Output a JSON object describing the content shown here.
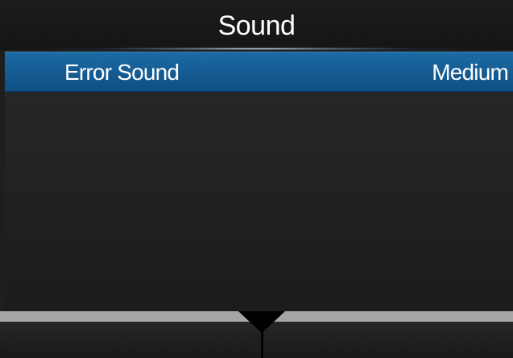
{
  "header": {
    "title": "Sound"
  },
  "list": {
    "items": [
      {
        "label": "Error Sound",
        "value": "Medium",
        "selected": true
      }
    ]
  },
  "colors": {
    "background": "#1e1e1e",
    "selection": "#1565a0",
    "text": "#ffffff",
    "footer_bar": "#a6a6a6"
  }
}
